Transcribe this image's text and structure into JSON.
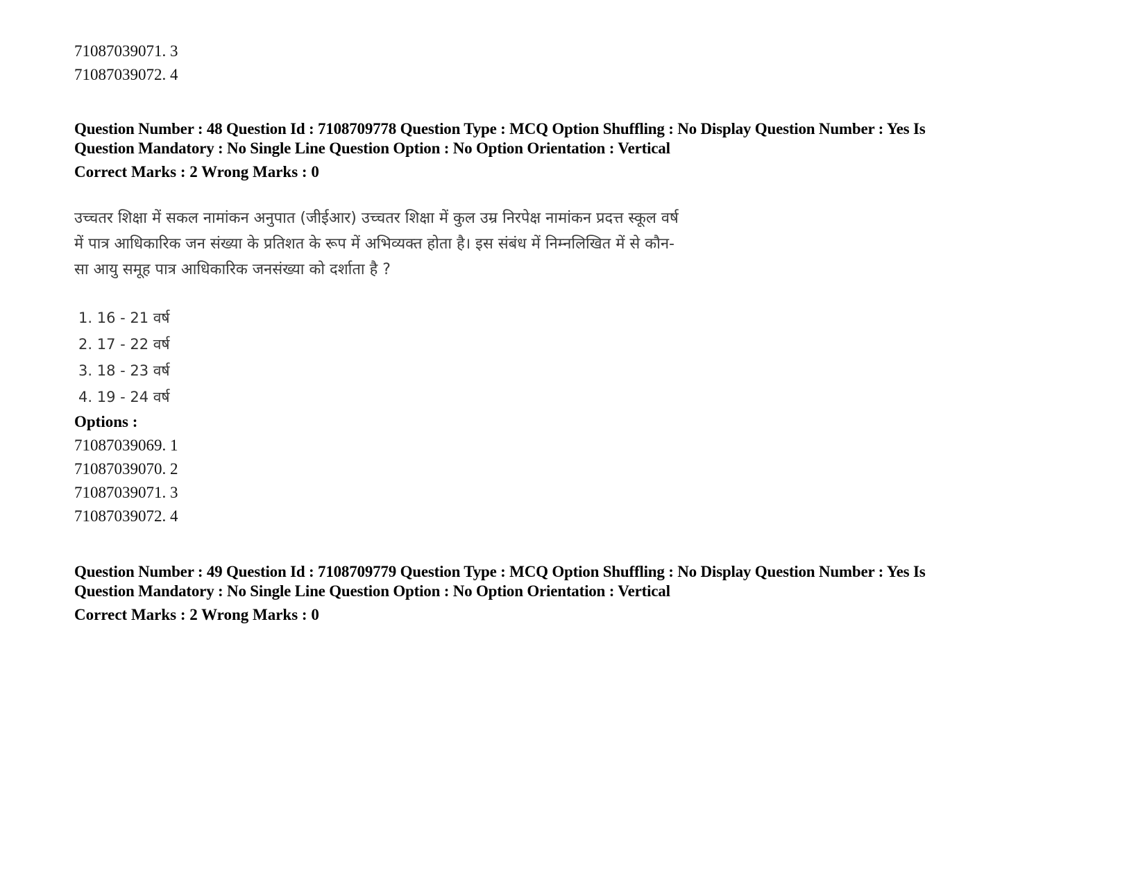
{
  "previous_question_tail": {
    "options": [
      {
        "id": "71087039071",
        "number": "3"
      },
      {
        "id": "71087039072",
        "number": "4"
      }
    ]
  },
  "question_48": {
    "meta_line_1": "Question Number : 48 Question Id : 7108709778 Question Type : MCQ Option Shuffling : No Display Question Number : Yes Is",
    "meta_line_2": "Question Mandatory : No Single Line Question Option : No Option Orientation : Vertical",
    "marks": "Correct Marks : 2 Wrong Marks : 0",
    "text_lines": [
      "उच्चतर शिक्षा में सकल नामांकन अनुपात (जीईआर) उच्चतर शिक्षा में कुल उम्र निरपेक्ष नामांकन प्रदत्त स्कूल वर्ष",
      "में पात्र आधिकारिक जन संख्या के प्रतिशत के रूप में अभिव्यक्त होता है। इस संबंध में निम्नलिखित में से कौन-",
      "सा आयु समूह पात्र  आधिकारिक जनसंख्या को दर्शाता है ?"
    ],
    "choices": [
      "1. 16 - 21 वर्ष",
      "2. 17 - 22 वर्ष",
      "3. 18 - 23 वर्ष",
      "4. 19 - 24 वर्ष"
    ],
    "options_label": "Options :",
    "options": [
      {
        "id": "71087039069",
        "number": "1"
      },
      {
        "id": "71087039070",
        "number": "2"
      },
      {
        "id": "71087039071",
        "number": "3"
      },
      {
        "id": "71087039072",
        "number": "4"
      }
    ]
  },
  "question_49": {
    "meta_line_1": "Question Number : 49 Question Id : 7108709779 Question Type : MCQ Option Shuffling : No Display Question Number : Yes Is",
    "meta_line_2": "Question Mandatory : No Single Line Question Option : No Option Orientation : Vertical",
    "marks": "Correct Marks : 2 Wrong Marks : 0"
  }
}
